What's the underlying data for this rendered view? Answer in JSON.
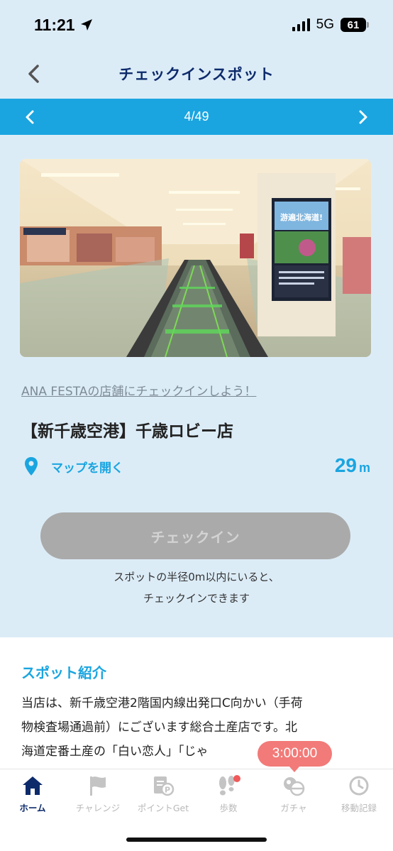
{
  "status": {
    "time": "11:21",
    "network": "5G",
    "battery": "61"
  },
  "header": {
    "title": "チェックインスポット"
  },
  "pager": {
    "position": "4/49"
  },
  "spot": {
    "campaign_link": "ANA FESTAの店舗にチェックインしよう！",
    "name": "【新千歳空港】千歳ロビー店",
    "map_label": "マップを開く",
    "distance_value": "29",
    "distance_unit": "m",
    "photo_sign_text": "游遍北海道!"
  },
  "checkin": {
    "button_label": "チェックイン",
    "note_line1": "スポットの半径0m以内にいると、",
    "note_line2": "チェックインできます"
  },
  "intro": {
    "title": "スポット紹介",
    "line1": "当店は、新千歳空港2階国内線出発口C向かい（手荷",
    "line2": "物検査場通過前）にございます総合土産店です。北",
    "line3": "海道定番土産の「白い恋人」「じゃ"
  },
  "timer": "3:00:00",
  "tabs": [
    {
      "label": "ホーム",
      "icon": "home-icon",
      "active": true
    },
    {
      "label": "チャレンジ",
      "icon": "flag-icon",
      "active": false
    },
    {
      "label": "ポイントGet",
      "icon": "point-icon",
      "active": false
    },
    {
      "label": "歩数",
      "icon": "footsteps-icon",
      "active": false
    },
    {
      "label": "ガチャ",
      "icon": "gacha-icon",
      "active": false
    },
    {
      "label": "移動記録",
      "icon": "clock-icon",
      "active": false
    }
  ],
  "colors": {
    "accent": "#1aa5e0",
    "navy": "#0d2b6b",
    "background": "#dcecf7",
    "badge": "#f27a78",
    "disabled": "#aaaaaa"
  }
}
